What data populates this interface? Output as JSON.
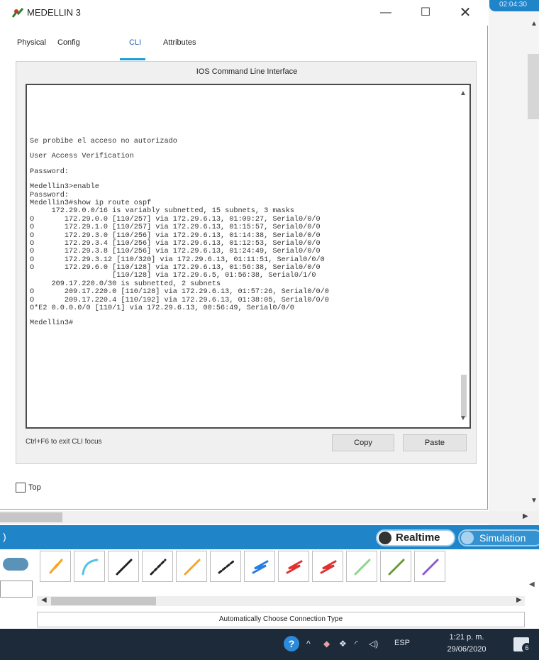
{
  "window": {
    "title": "MEDELLIN 3",
    "minimize_glyph": "—",
    "maximize_glyph": "☐",
    "close_glyph": "✕"
  },
  "tabs": [
    {
      "label": "Physical"
    },
    {
      "label": "Config"
    },
    {
      "label": "CLI",
      "active": true
    },
    {
      "label": "Attributes"
    }
  ],
  "panel": {
    "heading": "IOS Command Line Interface"
  },
  "terminal": {
    "lines": [
      "Se probibe el acceso no autorizado",
      "",
      "User Access Verification",
      "",
      "Password:",
      "",
      "Medellin3>enable",
      "Password:",
      "Medellin3#show ip route ospf",
      "     172.29.0.0/16 is variably subnetted, 15 subnets, 3 masks",
      "O       172.29.0.0 [110/257] via 172.29.6.13, 01:09:27, Serial0/0/0",
      "O       172.29.1.0 [110/257] via 172.29.6.13, 01:15:57, Serial0/0/0",
      "O       172.29.3.0 [110/256] via 172.29.6.13, 01:14:38, Serial0/0/0",
      "O       172.29.3.4 [110/256] via 172.29.6.13, 01:12:53, Serial0/0/0",
      "O       172.29.3.8 [110/256] via 172.29.6.13, 01:24:49, Serial0/0/0",
      "O       172.29.3.12 [110/320] via 172.29.6.13, 01:11:51, Serial0/0/0",
      "O       172.29.6.0 [110/128] via 172.29.6.13, 01:56:38, Serial0/0/0",
      "                   [110/128] via 172.29.6.5, 01:56:38, Serial0/1/0",
      "     209.17.220.0/30 is subnetted, 2 subnets",
      "O       209.17.220.0 [110/128] via 172.29.6.13, 01:57:26, Serial0/0/0",
      "O       209.17.220.4 [110/192] via 172.29.6.13, 01:38:05, Serial0/0/0",
      "O*E2 0.0.0.0/0 [110/1] via 172.29.6.13, 00:56:49, Serial0/0/0",
      "",
      "Medellin3#"
    ]
  },
  "controls": {
    "focus_hint": "Ctrl+F6 to exit CLI focus",
    "copy_label": "Copy",
    "paste_label": "Paste",
    "top_label": "Top",
    "top_checked": false
  },
  "background_app": {
    "clock_badge": "02:04:30"
  },
  "modebar": {
    "realtime_label": "Realtime",
    "simulation_label": "Simulation",
    "accent": "#1f85c8"
  },
  "palette": {
    "connection_type_label": "Automatically Choose Connection Type",
    "items": [
      {
        "name": "automatic-connection",
        "color": "#f5a623"
      },
      {
        "name": "console-connection",
        "color": "#56c2e6"
      },
      {
        "name": "copper-straight-through",
        "color": "#222222"
      },
      {
        "name": "copper-cross-over",
        "color": "#222222"
      },
      {
        "name": "fiber",
        "color": "#f5a623"
      },
      {
        "name": "phone",
        "color": "#222222"
      },
      {
        "name": "coaxial",
        "color": "#2a7de1"
      },
      {
        "name": "serial-dce",
        "color": "#e03030"
      },
      {
        "name": "serial-dte",
        "color": "#e03030"
      },
      {
        "name": "octal",
        "color": "#8fd48f"
      },
      {
        "name": "iot",
        "color": "#6a9a3a"
      },
      {
        "name": "usb",
        "color": "#8e5ad0"
      }
    ]
  },
  "taskbar": {
    "help_glyph": "?",
    "chevron": "^",
    "lang": "ESP",
    "time": "1:21 p. m.",
    "date": "29/06/2020",
    "notification_count": "6"
  }
}
